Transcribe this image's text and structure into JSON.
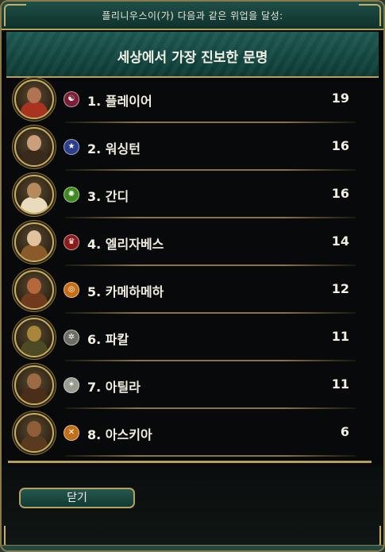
{
  "header": {
    "top_text": "플리니우스이(가) 다음과 같은 위업을 달성:"
  },
  "title": "세상에서 가장 진보한 문명",
  "leaders": [
    {
      "rank_name": "1. 플레이어",
      "score": "19",
      "emblem": "korea-emblem-icon",
      "emblem_bg": "#7a1e36",
      "glyph": "☯",
      "skin": "#b07450",
      "robe": "#a8341f"
    },
    {
      "rank_name": "2. 워싱턴",
      "score": "16",
      "emblem": "america-emblem-icon",
      "emblem_bg": "#2b3f8a",
      "glyph": "★",
      "skin": "#caa07c",
      "robe": "#3a2a1c"
    },
    {
      "rank_name": "3. 간디",
      "score": "16",
      "emblem": "india-emblem-icon",
      "emblem_bg": "#3f8a1f",
      "glyph": "✺",
      "skin": "#b58a5c",
      "robe": "#e9dcbc"
    },
    {
      "rank_name": "4. 엘리자베스",
      "score": "14",
      "emblem": "england-emblem-icon",
      "emblem_bg": "#8c1c1c",
      "glyph": "♛",
      "skin": "#e0c2a0",
      "robe": "#8a5a2a"
    },
    {
      "rank_name": "5. 카메하메하",
      "score": "12",
      "emblem": "polynesia-emblem-icon",
      "emblem_bg": "#c76c12",
      "glyph": "◎",
      "skin": "#b5683a",
      "robe": "#6f3a1e"
    },
    {
      "rank_name": "6. 파칼",
      "score": "11",
      "emblem": "maya-emblem-icon",
      "emblem_bg": "#6e6e66",
      "glyph": "✲",
      "skin": "#a8863a",
      "robe": "#4e4a24"
    },
    {
      "rank_name": "7. 아틸라",
      "score": "11",
      "emblem": "huns-emblem-icon",
      "emblem_bg": "#9a9a90",
      "glyph": "✶",
      "skin": "#9c6a44",
      "robe": "#4a2e1a"
    },
    {
      "rank_name": "8. 아스키아",
      "score": "6",
      "emblem": "songhai-emblem-icon",
      "emblem_bg": "#c0701a",
      "glyph": "✕",
      "skin": "#8f5e38",
      "robe": "#5a3a1e"
    }
  ],
  "close_button": "닫기"
}
